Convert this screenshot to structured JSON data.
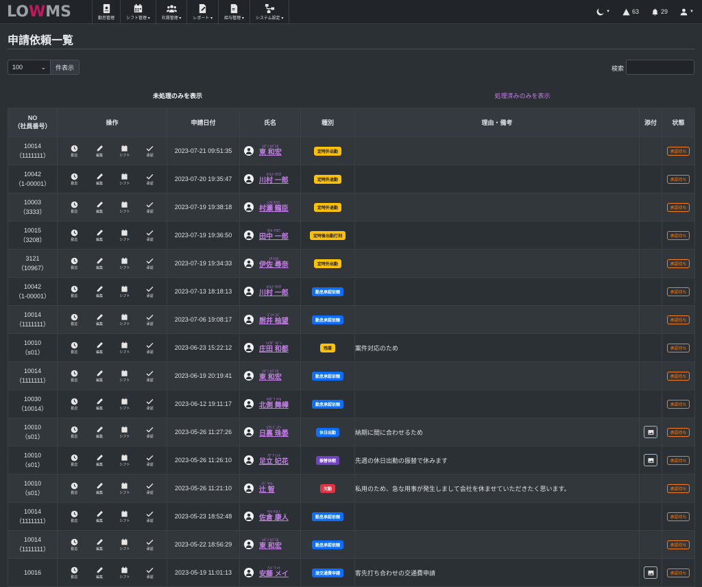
{
  "app": {
    "logo_left": "LO",
    "logo_w": "W",
    "logo_right": "MS"
  },
  "nav": [
    {
      "label": "勤怠管理",
      "icon": "id-badge-icon",
      "caret": false
    },
    {
      "label": "シフト管理",
      "icon": "calendar-icon",
      "caret": true
    },
    {
      "label": "社員管理",
      "icon": "users-icon",
      "caret": true
    },
    {
      "label": "レポート",
      "icon": "report-icon",
      "caret": true
    },
    {
      "label": "給与管理",
      "icon": "payroll-icon",
      "caret": true
    },
    {
      "label": "システム設定",
      "icon": "sitemap-icon",
      "caret": true
    }
  ],
  "nav_right": {
    "alerts_count": "63",
    "notifications_count": "29"
  },
  "page": {
    "title": "申請依頼一覧"
  },
  "controls": {
    "per_page_value": "100",
    "per_page_suffix": "件表示",
    "search_label": "検索"
  },
  "tabs": {
    "active": "未処理のみを表示",
    "inactive": "処理済みのみを表示"
  },
  "colors": {
    "link": "#c37ee6",
    "warning": "#ffc107",
    "primary": "#0d6efd",
    "success": "#198754",
    "purple": "#6f42c1",
    "danger": "#dc3545",
    "status": "#fd7e14"
  },
  "table": {
    "headers": {
      "no_line1": "NO",
      "no_line2": "（社員番号）",
      "ops": "操作",
      "date": "申請日付",
      "name": "氏名",
      "kind": "種別",
      "reason": "理由・備考",
      "attach": "添付",
      "status": "状態"
    },
    "op_labels": {
      "attendance": "勤怠",
      "edit": "編集",
      "shift": "シフト",
      "approve": "承認"
    },
    "rows": [
      {
        "no": "10014",
        "emp": "（1111111）",
        "date": "2023-07-21 09:51:35",
        "kana": "ﾋｶﾞｼ ｶｽﾞﾋﾛ",
        "name": "東 和宏",
        "kind": "定時外出勤",
        "kind_color": "warning",
        "reason": "",
        "attach": false,
        "status": "承認待ち"
      },
      {
        "no": "10042",
        "emp": "（1-00001）",
        "date": "2023-07-20 19:35:47",
        "kana": "ｶﾜﾑﾗ ｲﾁﾛｳ",
        "name": "川村 一郎",
        "kind": "定時外退勤",
        "kind_color": "warning",
        "reason": "",
        "attach": false,
        "status": "承認待ち"
      },
      {
        "no": "10003",
        "emp": "（3333）",
        "date": "2023-07-19 19:38:18",
        "kana": "ﾑﾗｾ ﾀﾂｵﾐ",
        "name": "村瀬 龍臣",
        "kind": "定時外退勤",
        "kind_color": "warning",
        "reason": "",
        "attach": false,
        "status": "承認待ち"
      },
      {
        "no": "10015",
        "emp": "（3208）",
        "date": "2023-07-19 19:36:50",
        "kana": "ﾀﾅｶ ｲﾁﾛｳ",
        "name": "田中 一郎",
        "kind": "定時後出勤打刻",
        "kind_color": "warning",
        "reason": "",
        "attach": false,
        "status": "承認待ち"
      },
      {
        "no": "3121",
        "emp": "（10967）",
        "date": "2023-07-19 19:34:33",
        "kana": "ｲｻ ﾋﾛﾅ",
        "name": "伊佐 尋奈",
        "kind": "定時外出勤",
        "kind_color": "warning",
        "reason": "",
        "attach": false,
        "status": "承認待ち"
      },
      {
        "no": "10042",
        "emp": "（1-00001）",
        "date": "2023-07-13 18:18:13",
        "kana": "ｶﾜﾑﾗ ｲﾁﾛｳ",
        "name": "川村 一郎",
        "kind": "勤怠承認依頼",
        "kind_color": "primary",
        "reason": "",
        "attach": false,
        "status": "承認待ち"
      },
      {
        "no": "10014",
        "emp": "（1111111）",
        "date": "2023-07-06 19:08:17",
        "kana": "ｽﾞｼｲ ﾕｽﾞ",
        "name": "厨井 柚望",
        "kind": "勤怠承認依頼",
        "kind_color": "primary",
        "reason": "",
        "attach": false,
        "status": "承認待ち"
      },
      {
        "no": "10010",
        "emp": "（s01）",
        "date": "2023-06-23 15:22:12",
        "kana": "ｼｮｳﾀﾞ ｶｽﾞﾄ",
        "name": "庄田 和都",
        "kind": "残業",
        "kind_color": "warning",
        "reason": "案件対応のため",
        "attach": false,
        "status": "承認待ち"
      },
      {
        "no": "10014",
        "emp": "（1111111）",
        "date": "2023-06-19 20:19:41",
        "kana": "ﾋｶﾞｼ ｶｽﾞﾋﾛ",
        "name": "東 和宏",
        "kind": "勤怠承認依頼",
        "kind_color": "primary",
        "reason": "",
        "attach": false,
        "status": "承認待ち"
      },
      {
        "no": "10030",
        "emp": "（10014）",
        "date": "2023-06-12 19:11:17",
        "kana": "ｷﾀｶﾞﾜ ﾏｲｶ",
        "name": "北側 舞樺",
        "kind": "勤怠承認依頼",
        "kind_color": "primary",
        "reason": "",
        "attach": false,
        "status": "承認待ち"
      },
      {
        "no": "10010",
        "emp": "（s01）",
        "date": "2023-05-26 11:27:26",
        "kana": "ﾋｳﾗ ｼﾞｭｱﾝ",
        "name": "日裏 珠晏",
        "kind": "休日出勤",
        "kind_color": "primary",
        "reason": "納期に間に合わせるため",
        "attach": true,
        "status": "承認待ち"
      },
      {
        "no": "10010",
        "emp": "（s01）",
        "date": "2023-05-26 11:26:10",
        "kana": "ｱﾀﾞﾁ ﾋﾉｶ",
        "name": "足立 妃花",
        "kind": "振替休暇",
        "kind_color": "purple",
        "reason": "先週の休日出勤の振替で休みます",
        "attach": true,
        "status": "承認待ち"
      },
      {
        "no": "10010",
        "emp": "（s01）",
        "date": "2023-05-26 11:21:10",
        "kana": "ﾂｼﾞ ｻﾄﾙ",
        "name": "辻 智",
        "kind": "欠勤",
        "kind_color": "danger",
        "reason": "私用のため、急な用事が発生しまして会社を休ませていただきたく思います。",
        "attach": false,
        "status": "承認待ち"
      },
      {
        "no": "10014",
        "emp": "（1111111）",
        "date": "2023-05-23 18:52:48",
        "kana": "ｻｸﾗ ﾔｽﾋﾄ",
        "name": "佐倉 康人",
        "kind": "勤怠承認依頼",
        "kind_color": "primary",
        "reason": "",
        "attach": false,
        "status": "承認待ち"
      },
      {
        "no": "10014",
        "emp": "（1111111）",
        "date": "2023-05-22 18:56:29",
        "kana": "ﾋｶﾞｼ ｶｽﾞﾋﾛ",
        "name": "東 和宏",
        "kind": "勤怠承認依頼",
        "kind_color": "primary",
        "reason": "",
        "attach": false,
        "status": "承認待ち"
      },
      {
        "no": "10016",
        "emp": "",
        "date": "2023-05-19 11:01:13",
        "kana": "ｱﾝﾄﾞｳ ﾒｲ",
        "name": "安藤 メイ",
        "kind": "旅交通費申請",
        "kind_color": "primary",
        "reason": "客先打ち合わせの交通費申請",
        "attach": true,
        "status": "承認待ち"
      }
    ]
  }
}
